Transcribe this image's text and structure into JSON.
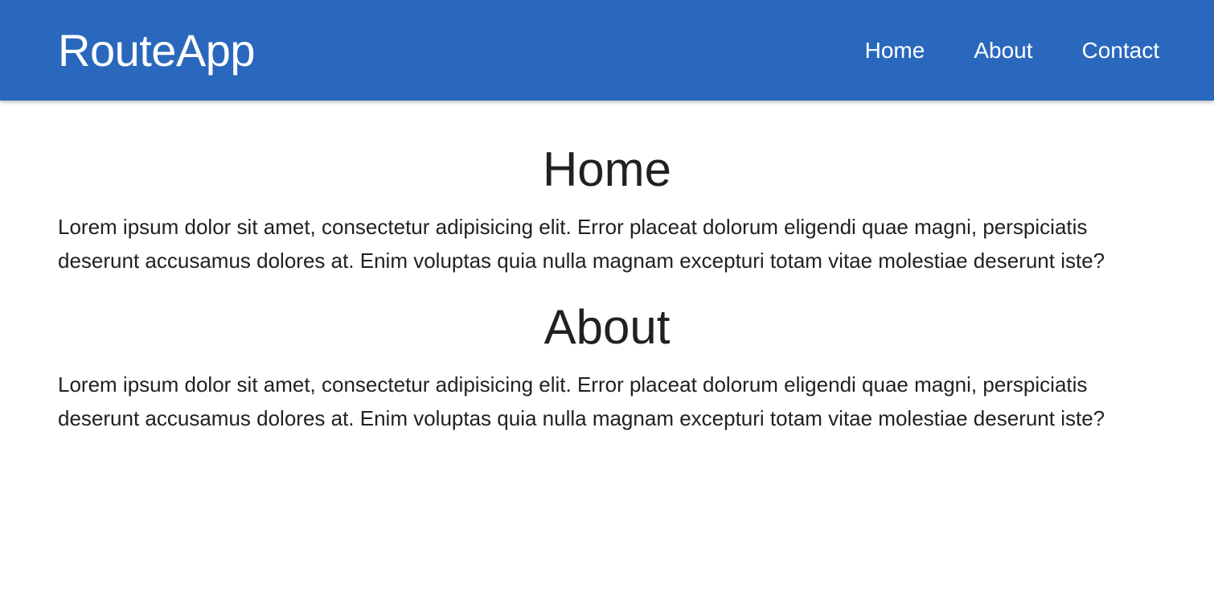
{
  "navbar": {
    "brand": "RouteApp",
    "links": [
      {
        "label": "Home"
      },
      {
        "label": "About"
      },
      {
        "label": "Contact"
      }
    ],
    "color": "#2a68bd"
  },
  "sections": [
    {
      "title": "Home",
      "text": "Lorem ipsum dolor sit amet, consectetur adipisicing elit. Error placeat dolorum eligendi quae magni, perspiciatis deserunt accusamus dolores at. Enim voluptas quia nulla magnam excepturi totam vitae molestiae deserunt iste?"
    },
    {
      "title": "About",
      "text": "Lorem ipsum dolor sit amet, consectetur adipisicing elit. Error placeat dolorum eligendi quae magni, perspiciatis deserunt accusamus dolores at. Enim voluptas quia nulla magnam excepturi totam vitae molestiae deserunt iste?"
    }
  ]
}
